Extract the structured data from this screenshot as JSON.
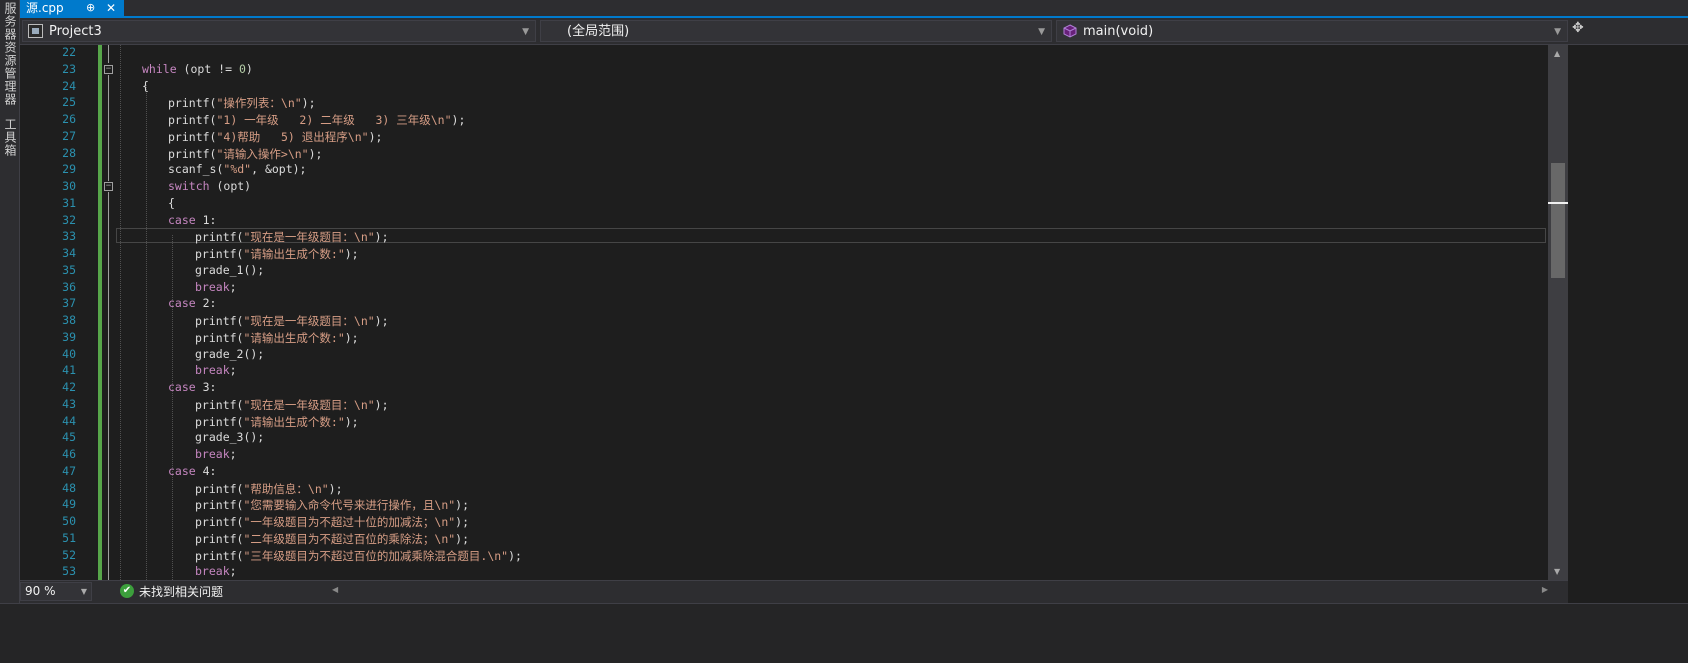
{
  "side_panel": {
    "server_explorer": "服务器资源管理器",
    "toolbox": "工具箱"
  },
  "tab": {
    "label": "源.cpp",
    "pin": "⊕",
    "close": "✕"
  },
  "nav": {
    "project": "Project3",
    "scope": "(全局范围)",
    "member": "main(void)"
  },
  "editor": {
    "line_numbers": [
      "22",
      "23",
      "24",
      "25",
      "26",
      "27",
      "28",
      "29",
      "30",
      "31",
      "32",
      "33",
      "34",
      "35",
      "36",
      "37",
      "38",
      "39",
      "40",
      "41",
      "42",
      "43",
      "44",
      "45",
      "46",
      "47",
      "48",
      "49",
      "50",
      "51",
      "52",
      "53"
    ],
    "current_line": "33"
  },
  "code": {
    "l23_kw": "while",
    "l23_rest": " (opt != ",
    "l23_num": "0",
    "l23_end": ")",
    "l24": "{",
    "l25_fn": "printf(",
    "l25_str": "\"操作列表：\\n\"",
    "l25_end": ");",
    "l26_str": "\"1) 一年级   2) 二年级   3) 三年级\\n\"",
    "l27_str": "\"4)帮助   5) 退出程序\\n\"",
    "l28_str": "\"请输入操作>\\n\"",
    "l29_fn": "scanf_s(",
    "l29_str": "\"%d\"",
    "l29_end": ", &opt);",
    "l30_kw": "switch",
    "l30_rest": " (opt)",
    "l31": "{",
    "case_kw": "case",
    "case1": " 1:",
    "case2": " 2:",
    "case3": " 3:",
    "case4": " 4:",
    "printf": "printf(",
    "end": ");",
    "s_now": "\"现在是一年级题目：\\n\"",
    "s_gen": "\"请输出生成个数:\"",
    "grade1": "grade_1();",
    "grade2": "grade_2();",
    "grade3": "grade_3();",
    "break": "break",
    "semi": ";",
    "s_help": "\"帮助信息：\\n\"",
    "s49": "\"您需要输入命令代号来进行操作，且\\n\"",
    "s50": "\"一年级题目为不超过十位的加减法；\\n\"",
    "s51": "\"二年级题目为不超过百位的乘除法；\\n\"",
    "s52": "\"三年级题目为不超过百位的加减乘除混合题目.\\n\""
  },
  "status": {
    "zoom": "90 %",
    "issues": "未找到相关问题"
  },
  "colors": {
    "accent": "#007acc",
    "keyword": "#c586c0",
    "string": "#d69d85",
    "line_number": "#2b91af",
    "change_bar": "#57a64a"
  }
}
